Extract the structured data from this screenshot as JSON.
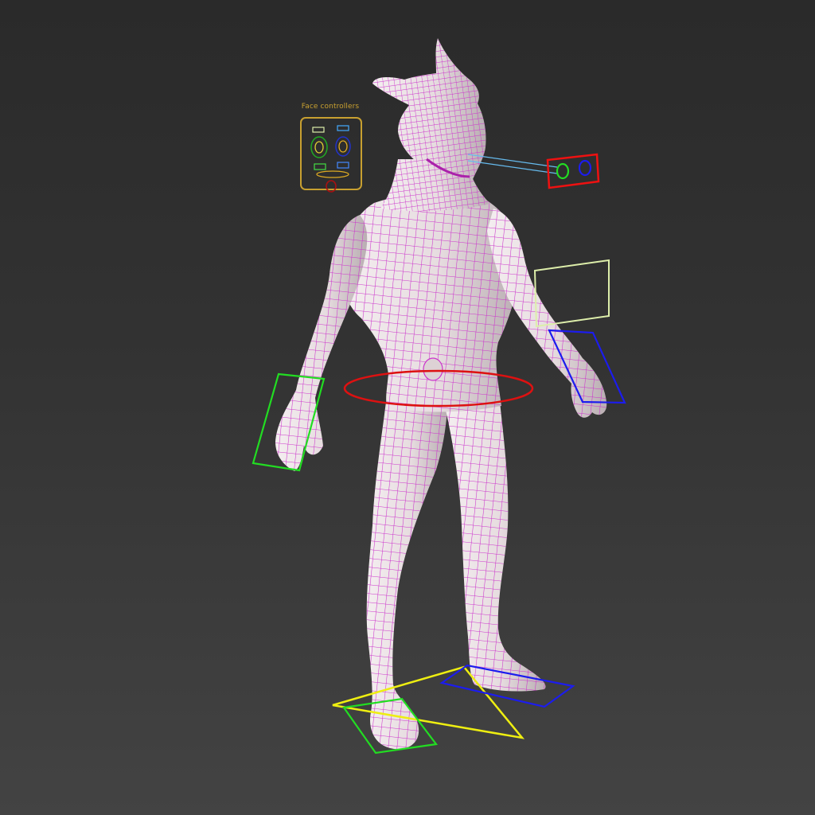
{
  "viewport": {
    "face_panel_label": "Face controllers"
  },
  "colors": {
    "background": "#2f2f2f",
    "mesh_fill": "#e9e0e2",
    "wireframe": "#cc33cc",
    "face_panel": "#c8a030",
    "eye_look_target": "#ee1111",
    "eye_left": "#22dd22",
    "eye_right": "#1c1cee",
    "hip_controller": "#dd1111",
    "right_hand_controller": "#22dd22",
    "left_hand_controller": "#1c1cee",
    "chest_controller": "#ddeeaa",
    "foot_root_controller": "#eeee11",
    "right_foot_controller": "#22dd22",
    "left_foot_controller": "#1c1cee"
  }
}
